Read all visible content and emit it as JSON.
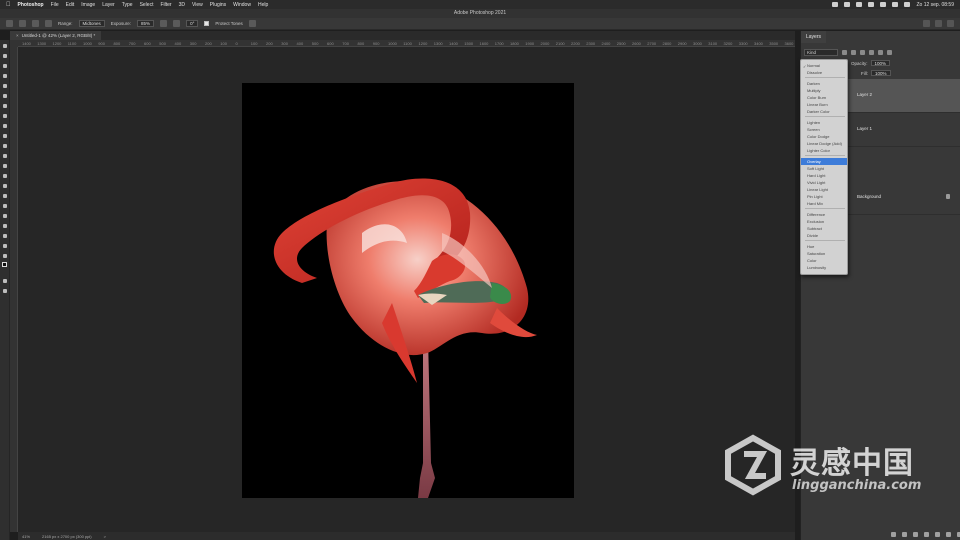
{
  "menubar": {
    "app": "Photoshop",
    "items": [
      "File",
      "Edit",
      "Image",
      "Layer",
      "Type",
      "Select",
      "Filter",
      "3D",
      "View",
      "Plugins",
      "Window",
      "Help"
    ],
    "clock": "Zo 12 sep. 08:59"
  },
  "window": {
    "title": "Adobe Photoshop 2021"
  },
  "options": {
    "range_label": "Range:",
    "range_value": "Midtones",
    "exposure_label": "Exposure:",
    "exposure_value": "85%",
    "angle_value": "0°",
    "protect_label": "Protect Tones"
  },
  "document": {
    "tab_title": "Untitled-1 @ 42% (Layer 2, RGB/8) *"
  },
  "ruler": {
    "h_ticks": [
      "1400",
      "1300",
      "1200",
      "1100",
      "1000",
      "900",
      "800",
      "700",
      "600",
      "500",
      "400",
      "300",
      "200",
      "100",
      "0",
      "100",
      "200",
      "300",
      "400",
      "500",
      "600",
      "700",
      "800",
      "900",
      "1000",
      "1100",
      "1200",
      "1300",
      "1400",
      "1500",
      "1600",
      "1700",
      "1800",
      "1900",
      "2000",
      "2100",
      "2200",
      "2300",
      "2400",
      "2500",
      "2600",
      "2700",
      "2800",
      "2900",
      "3000",
      "3100",
      "3200",
      "3300",
      "3400",
      "3500",
      "3600"
    ]
  },
  "status": {
    "zoom": "41%",
    "doc_size": "2165 px x 2700 px (300 ppi)",
    "arrow": ">"
  },
  "layers_panel": {
    "tab": "Layers",
    "search": "Kind",
    "opacity_label": "Opacity:",
    "opacity_value": "100%",
    "fill_label": "Fill:",
    "fill_value": "100%",
    "layers": [
      {
        "name": "Layer 2"
      },
      {
        "name": "Layer 1"
      },
      {
        "name": "Background"
      }
    ]
  },
  "blend_modes": {
    "groups": [
      [
        "Normal",
        "Dissolve"
      ],
      [
        "Darken",
        "Multiply",
        "Color Burn",
        "Linear Burn",
        "Darker Color"
      ],
      [
        "Lighten",
        "Screen",
        "Color Dodge",
        "Linear Dodge (Add)",
        "Lighter Color"
      ],
      [
        "Overlay",
        "Soft Light",
        "Hard Light",
        "Vivid Light",
        "Linear Light",
        "Pin Light",
        "Hard Mix"
      ],
      [
        "Difference",
        "Exclusion",
        "Subtract",
        "Divide"
      ],
      [
        "Hue",
        "Saturation",
        "Color",
        "Luminosity"
      ]
    ],
    "current": "Normal",
    "highlighted": "Overlay"
  },
  "watermark": {
    "cn": "灵感中国",
    "en": "lingganchina.com"
  }
}
